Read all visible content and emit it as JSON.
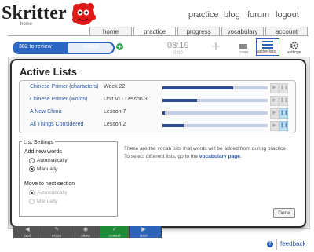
{
  "app": {
    "logo": "Skritter",
    "logo_sub": "home"
  },
  "topnav": {
    "practice": "practice",
    "blog": "blog",
    "forum": "forum",
    "logout": "logout"
  },
  "tabs": {
    "home": "home",
    "practice": "practice",
    "progress": "progress",
    "vocabulary": "vocabulary",
    "account": "account"
  },
  "status": {
    "to_review": "382 to review",
    "added": "added",
    "review_fill_fraction": 0.55,
    "plus": "+",
    "timer": "08:19",
    "timer_small": "0:00",
    "cram_label": "cram",
    "active_lists_label": "active lists",
    "settings_label": "settings"
  },
  "modal": {
    "title": "Active Lists",
    "lists": [
      {
        "name": "Chinese Primer (characters)",
        "section": "Week 22",
        "progress": 0.67
      },
      {
        "name": "Chinese Primer (words)",
        "section": "Unit VI - Lesson 3",
        "progress": 0.33
      },
      {
        "name": "A New China",
        "section": "Lesson 7",
        "progress": 0.02
      },
      {
        "name": "All Things Considered",
        "section": "Lesson 2",
        "progress": 0.2
      }
    ],
    "list_settings": {
      "title": "List Settings",
      "add_new_words": "Add new words",
      "automatically": "Automatically",
      "manually": "Manually",
      "move_to_next": "Move to next section",
      "automatically2": "Automatically",
      "manually2": "Manually"
    },
    "info_text": "These are the vocab lists that words will be added from during practice. To select different lists, go to the ",
    "info_link": "vocabulary page",
    "info_end": ".",
    "done": "Done"
  },
  "toolbar": {
    "back": "back",
    "erase": "erase",
    "show": "show",
    "correct": "correct",
    "next": "next"
  },
  "footer": {
    "help": "?",
    "feedback": "feedback"
  },
  "colors": {
    "brand_blue": "#2b66c4",
    "link": "#2d5aa8",
    "correct_green": "#1f8a37"
  }
}
